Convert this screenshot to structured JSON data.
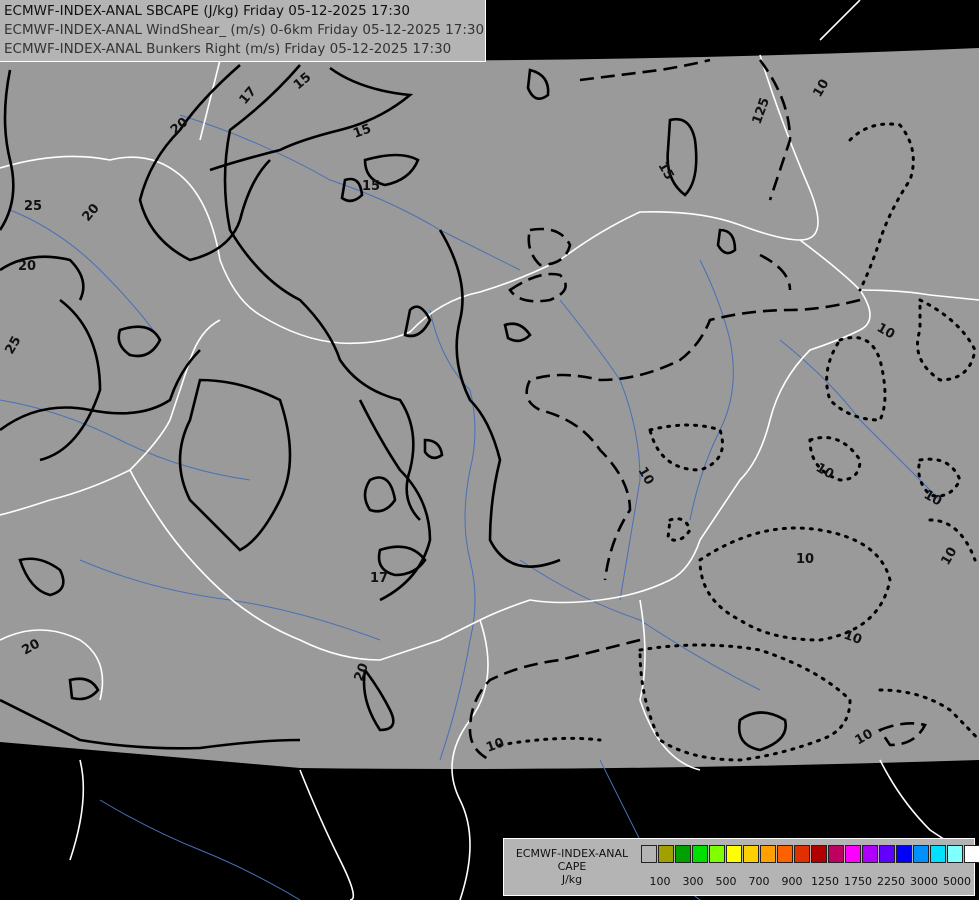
{
  "title": {
    "line1": "ECMWF-INDEX-ANAL SBCAPE (J/kg) Friday 05-12-2025 17:30",
    "line2": "ECMWF-INDEX-ANAL WindShear_ (m/s) 0-6km Friday 05-12-2025 17:30",
    "line3": "ECMWF-INDEX-ANAL Bunkers Right (m/s) Friday 05-12-2025 17:30"
  },
  "legend": {
    "line1": "ECMWF-INDEX-ANAL",
    "line2": "CAPE",
    "line3": "J/kg",
    "colors": [
      "#b4b4b4",
      "#a0a000",
      "#00a000",
      "#00e000",
      "#80ff00",
      "#ffff00",
      "#ffd000",
      "#ffa000",
      "#ff6000",
      "#e03000",
      "#b00000",
      "#c00060",
      "#ff00ff",
      "#b000ff",
      "#6000ff",
      "#0000ff",
      "#0090ff",
      "#00e0ff",
      "#80ffff",
      "#ffffff"
    ],
    "ticks": [
      "100",
      "300",
      "500",
      "700",
      "900",
      "1250",
      "1750",
      "2250",
      "3000",
      "5000"
    ]
  },
  "contour_labels": [
    {
      "text": "17"
    },
    {
      "text": "15"
    },
    {
      "text": "15"
    },
    {
      "text": "15"
    },
    {
      "text": "20"
    },
    {
      "text": "20"
    },
    {
      "text": "25"
    },
    {
      "text": "20"
    },
    {
      "text": "25"
    },
    {
      "text": "125"
    },
    {
      "text": "10"
    },
    {
      "text": "15"
    },
    {
      "text": "17"
    },
    {
      "text": "20"
    },
    {
      "text": "20"
    },
    {
      "text": "10"
    },
    {
      "text": "10"
    },
    {
      "text": "10"
    },
    {
      "text": "10"
    },
    {
      "text": "10"
    },
    {
      "text": "10"
    },
    {
      "text": "10"
    },
    {
      "text": "10"
    },
    {
      "text": "10"
    }
  ]
}
